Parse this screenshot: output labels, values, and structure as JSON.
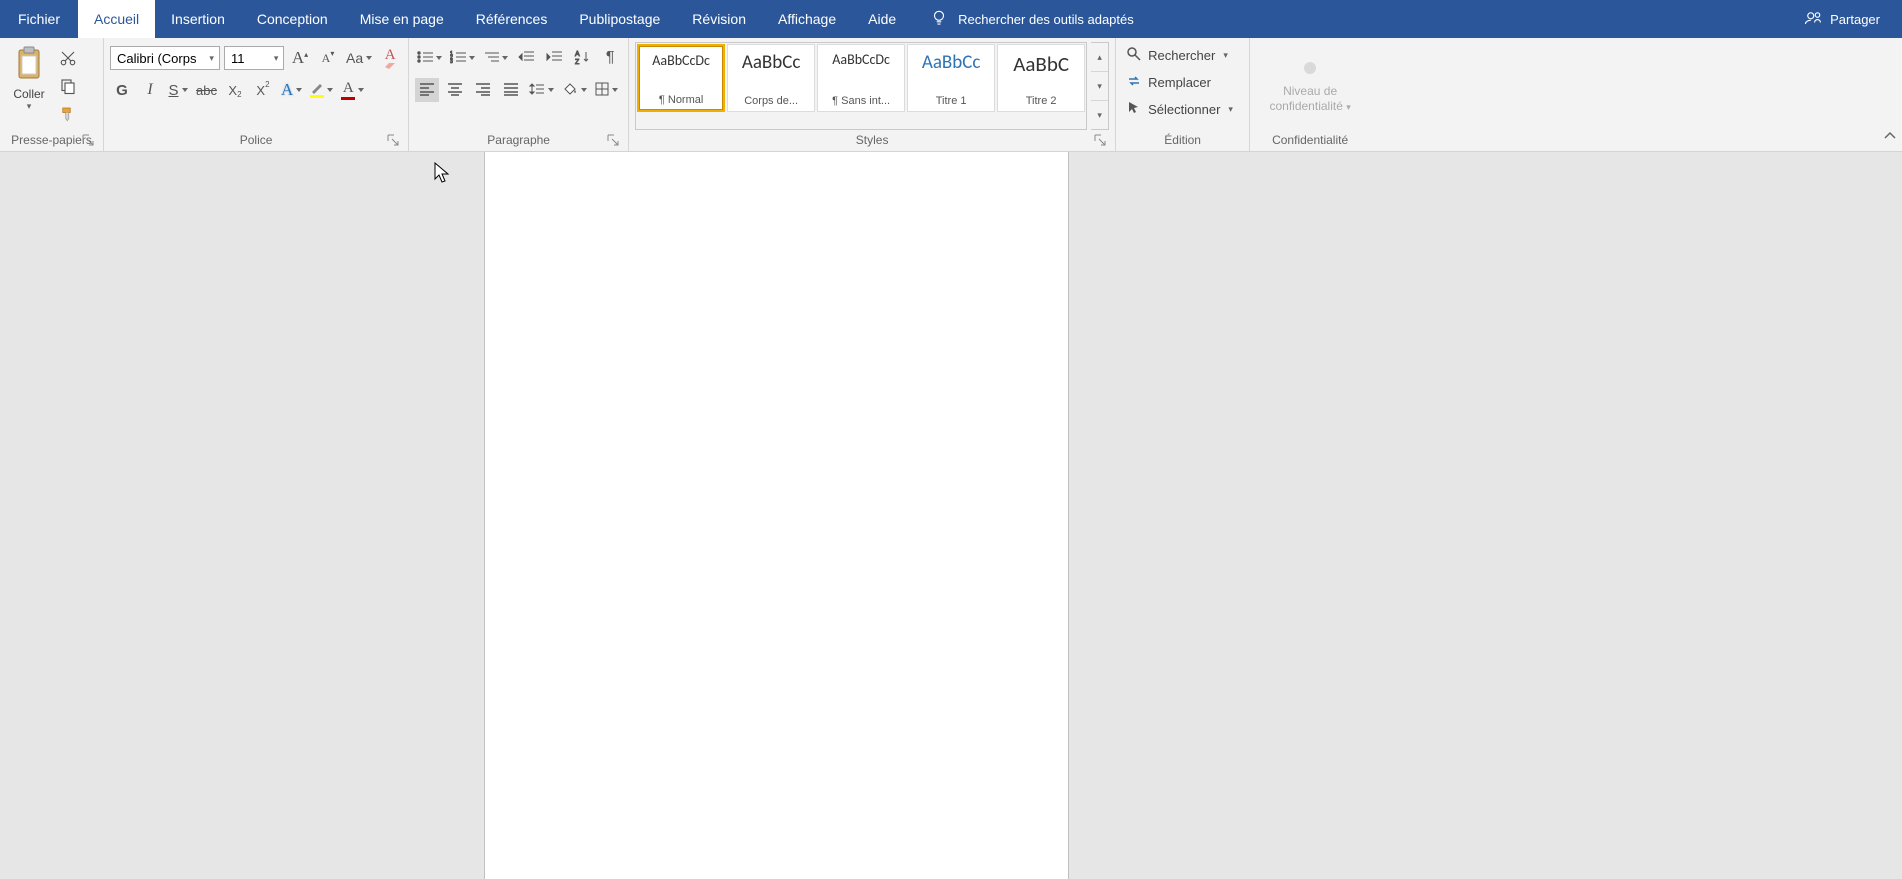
{
  "tabs": {
    "file": "Fichier",
    "home": "Accueil",
    "insert": "Insertion",
    "design": "Conception",
    "layout": "Mise en page",
    "references": "Références",
    "mailings": "Publipostage",
    "review": "Révision",
    "view": "Affichage",
    "help": "Aide"
  },
  "tellme": "Rechercher des outils adaptés",
  "share": "Partager",
  "clipboard": {
    "paste": "Coller",
    "label": "Presse-papiers"
  },
  "font": {
    "name": "Calibri (Corps",
    "size": "11",
    "label": "Police",
    "bold": "G",
    "italic": "I",
    "underline": "S",
    "strike": "abc",
    "sub_base": "X",
    "sup_base": "X"
  },
  "paragraph": {
    "label": "Paragraphe"
  },
  "styles": {
    "label": "Styles",
    "items": [
      {
        "preview": "AaBbCcDc",
        "name": "¶ Normal",
        "size": "14px",
        "color": "#333"
      },
      {
        "preview": "AaBbCc",
        "name": "Corps de...",
        "size": "19px",
        "color": "#333"
      },
      {
        "preview": "AaBbCcDc",
        "name": "¶ Sans int...",
        "size": "14px",
        "color": "#333"
      },
      {
        "preview": "AaBbCc",
        "name": "Titre 1",
        "size": "19px",
        "color": "#2e74b5"
      },
      {
        "preview": "AaBbC",
        "name": "Titre 2",
        "size": "21px",
        "color": "#333"
      }
    ]
  },
  "editing": {
    "find": "Rechercher",
    "replace": "Remplacer",
    "select": "Sélectionner",
    "label": "Édition"
  },
  "sensitivity": {
    "line1": "Niveau de",
    "line2": "confidentialité",
    "label": "Confidentialité"
  }
}
